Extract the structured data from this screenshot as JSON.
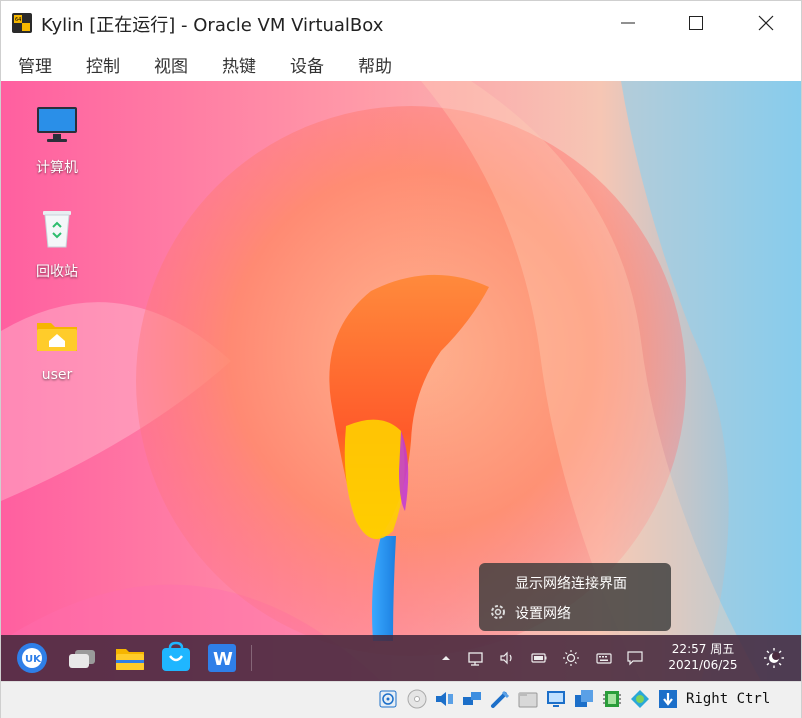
{
  "window": {
    "title": "Kylin [正在运行] - Oracle VM VirtualBox"
  },
  "menubar": {
    "items": [
      {
        "label": "管理"
      },
      {
        "label": "控制"
      },
      {
        "label": "视图"
      },
      {
        "label": "热键"
      },
      {
        "label": "设备"
      },
      {
        "label": "帮助"
      }
    ]
  },
  "desktop": {
    "icons": [
      {
        "label": "计算机",
        "icon": "computer-icon"
      },
      {
        "label": "回收站",
        "icon": "trash-icon"
      },
      {
        "label": "user",
        "icon": "home-folder-icon"
      }
    ]
  },
  "context_menu": {
    "items": [
      {
        "label": "显示网络连接界面"
      },
      {
        "label": "设置网络",
        "icon": "gear-icon"
      }
    ]
  },
  "taskbar": {
    "clock_time": "22:57 周五",
    "clock_date": "2021/06/25"
  },
  "statusbar": {
    "host_key": "Right Ctrl"
  },
  "colors": {
    "accent": "#ff7a45",
    "taskbar": "#4a2a3e",
    "menu_bg": "#3c3c3c"
  }
}
